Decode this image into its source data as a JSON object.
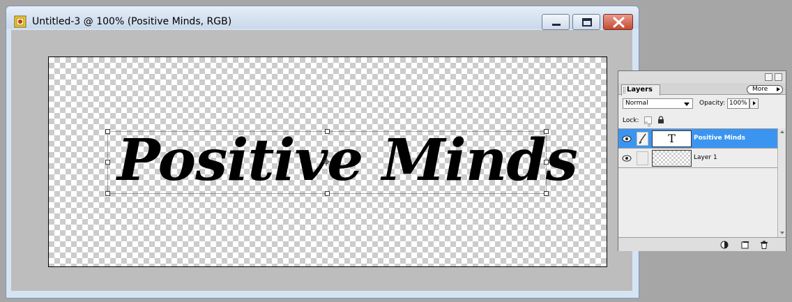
{
  "document": {
    "title": "Untitled-3 @ 100% (Positive Minds, RGB)",
    "canvas_text": "Positive Minds",
    "colors": {
      "canvas_bg": "#bdbdbd",
      "frame": "#d6e3f2",
      "close": "#c54a33"
    }
  },
  "window_controls": {
    "minimize": "minimize-icon",
    "maximize": "maximize-icon",
    "close": "close-icon"
  },
  "layers_panel": {
    "tab_label": "Layers",
    "more_label": "More",
    "blend_mode": "Normal",
    "opacity_label": "Opacity:",
    "opacity_value": "100%",
    "lock_label": "Lock:",
    "layers": [
      {
        "name": "Positive Minds",
        "kind": "text",
        "thumb_glyph": "T",
        "selected": true
      },
      {
        "name": "Layer 1",
        "kind": "pixel",
        "selected": false
      }
    ],
    "selection_color": "#3b95f0",
    "bottom_icons": [
      "adjustment-layer-icon",
      "new-layer-icon",
      "trash-icon"
    ]
  }
}
